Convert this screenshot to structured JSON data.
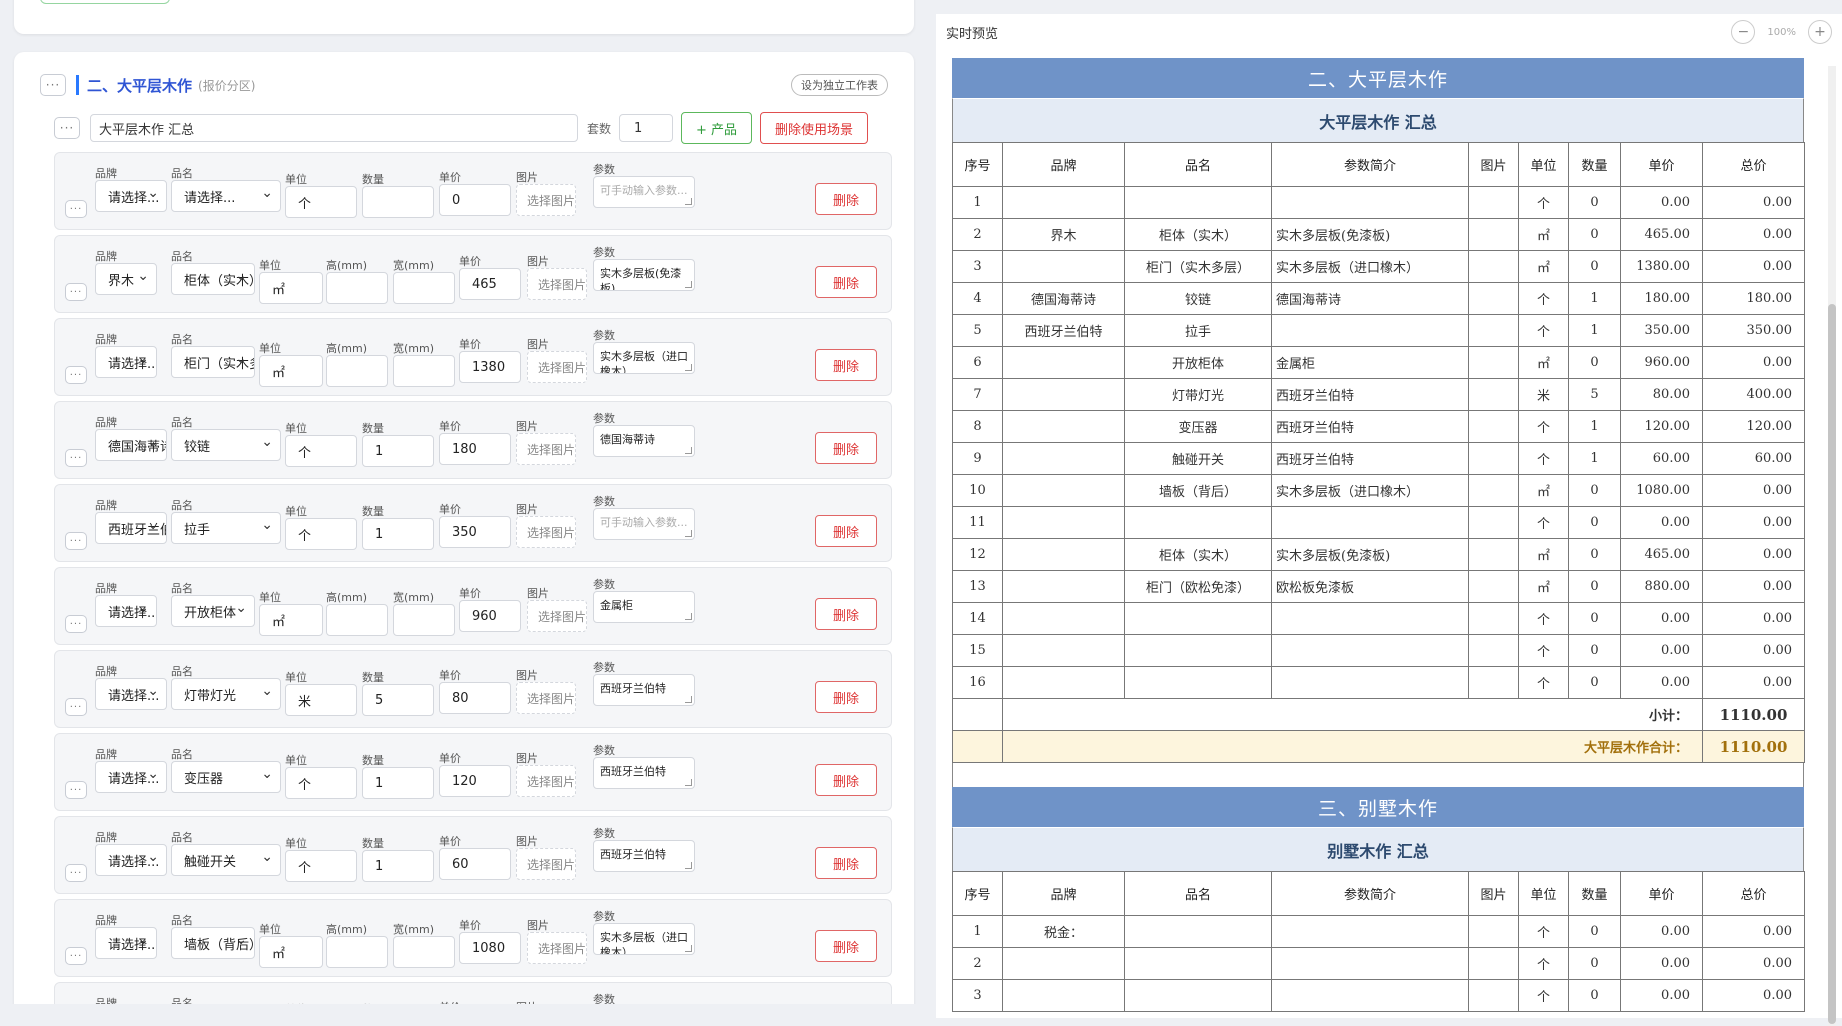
{
  "section": {
    "title": "二、大平层木作",
    "subtitle": "(报价分区)",
    "independent_button": "设为独立工作表",
    "more_label": "···",
    "scene_name": "大平层木作 汇总",
    "qty_label": "套数",
    "qty_value": "1",
    "add_product_button": "+ 产品",
    "delete_scene_button": "删除使用场景"
  },
  "labels": {
    "brand": "品牌",
    "name": "品名",
    "unit": "单位",
    "qty": "数量",
    "height": "高(mm)",
    "width": "宽(mm)",
    "price": "单价",
    "image": "图片",
    "params": "参数",
    "select_image": "选择图片",
    "delete": "删除"
  },
  "items": [
    {
      "brand": "请选择...",
      "name": "请选择...",
      "unit": "个",
      "mode": "qty",
      "qty": "",
      "price": "0",
      "params": "可手动输入参数...",
      "params_placeholder": true
    },
    {
      "brand": "界木",
      "name": "柜体（实木）",
      "unit": "㎡",
      "mode": "hw",
      "h": "",
      "w": "",
      "price": "465",
      "params": "实木多层板(免漆板)"
    },
    {
      "brand": "请选择...",
      "name": "柜门（实木多层）",
      "unit": "㎡",
      "mode": "hw",
      "h": "",
      "w": "",
      "price": "1380",
      "params": "实木多层板（进口橡木）"
    },
    {
      "brand": "德国海蒂诗",
      "name": "铰链",
      "unit": "个",
      "mode": "qty",
      "qty": "1",
      "price": "180",
      "params": "德国海蒂诗"
    },
    {
      "brand": "西班牙兰伯特",
      "name": "拉手",
      "unit": "个",
      "mode": "qty",
      "qty": "1",
      "price": "350",
      "params": "可手动输入参数...",
      "params_placeholder": true
    },
    {
      "brand": "请选择...",
      "name": "开放柜体",
      "unit": "㎡",
      "mode": "hw",
      "h": "",
      "w": "",
      "price": "960",
      "params": "金属柜"
    },
    {
      "brand": "请选择...",
      "name": "灯带灯光",
      "unit": "米",
      "mode": "qty",
      "qty": "5",
      "price": "80",
      "params": "西班牙兰伯特"
    },
    {
      "brand": "请选择...",
      "name": "变压器",
      "unit": "个",
      "mode": "qty",
      "qty": "1",
      "price": "120",
      "params": "西班牙兰伯特"
    },
    {
      "brand": "请选择...",
      "name": "触碰开关",
      "unit": "个",
      "mode": "qty",
      "qty": "1",
      "price": "60",
      "params": "西班牙兰伯特"
    },
    {
      "brand": "请选择...",
      "name": "墙板（背后）",
      "unit": "㎡",
      "mode": "hw",
      "h": "",
      "w": "",
      "price": "1080",
      "params": "实木多层板（进口橡木）"
    },
    {
      "brand": "",
      "name": "",
      "unit": "",
      "mode": "qty",
      "qty": "",
      "price": "",
      "params": ""
    }
  ],
  "preview": {
    "label": "实时预览",
    "zoom": "100%",
    "zoom_out": "−",
    "zoom_in": "+",
    "section2_title": "二、大平层木作",
    "section2_summary": "大平层木作  汇总",
    "columns": [
      "序号",
      "品牌",
      "品名",
      "参数简介",
      "图片",
      "单位",
      "数量",
      "单价",
      "总价"
    ],
    "rows": [
      [
        "1",
        "",
        "",
        "",
        "",
        "个",
        "0",
        "0.00",
        "0.00"
      ],
      [
        "2",
        "界木",
        "柜体（实木）",
        "实木多层板(免漆板)",
        "",
        "㎡",
        "0",
        "465.00",
        "0.00"
      ],
      [
        "3",
        "",
        "柜门（实木多层）",
        "实木多层板（进口橡木）",
        "",
        "㎡",
        "0",
        "1380.00",
        "0.00"
      ],
      [
        "4",
        "德国海蒂诗",
        "铰链",
        "德国海蒂诗",
        "",
        "个",
        "1",
        "180.00",
        "180.00"
      ],
      [
        "5",
        "西班牙兰伯特",
        "拉手",
        "",
        "",
        "个",
        "1",
        "350.00",
        "350.00"
      ],
      [
        "6",
        "",
        "开放柜体",
        "金属柜",
        "",
        "㎡",
        "0",
        "960.00",
        "0.00"
      ],
      [
        "7",
        "",
        "灯带灯光",
        "西班牙兰伯特",
        "",
        "米",
        "5",
        "80.00",
        "400.00"
      ],
      [
        "8",
        "",
        "变压器",
        "西班牙兰伯特",
        "",
        "个",
        "1",
        "120.00",
        "120.00"
      ],
      [
        "9",
        "",
        "触碰开关",
        "西班牙兰伯特",
        "",
        "个",
        "1",
        "60.00",
        "60.00"
      ],
      [
        "10",
        "",
        "墙板（背后）",
        "实木多层板（进口橡木）",
        "",
        "㎡",
        "0",
        "1080.00",
        "0.00"
      ],
      [
        "11",
        "",
        "",
        "",
        "",
        "个",
        "0",
        "0.00",
        "0.00"
      ],
      [
        "12",
        "",
        "柜体（实木）",
        "实木多层板(免漆板)",
        "",
        "㎡",
        "0",
        "465.00",
        "0.00"
      ],
      [
        "13",
        "",
        "柜门（欧松免漆）",
        "欧松板免漆板",
        "",
        "㎡",
        "0",
        "880.00",
        "0.00"
      ],
      [
        "14",
        "",
        "",
        "",
        "",
        "个",
        "0",
        "0.00",
        "0.00"
      ],
      [
        "15",
        "",
        "",
        "",
        "",
        "个",
        "0",
        "0.00",
        "0.00"
      ],
      [
        "16",
        "",
        "",
        "",
        "",
        "个",
        "0",
        "0.00",
        "0.00"
      ]
    ],
    "subtotal_label": "小计：",
    "subtotal_value": "1110.00",
    "grand_label": "大平层木作合计：",
    "grand_value": "1110.00",
    "section3_title": "三、别墅木作",
    "section3_summary": "别墅木作  汇总",
    "rows3": [
      [
        "1",
        "税金：",
        "",
        "",
        "",
        "个",
        "0",
        "0.00",
        "0.00"
      ],
      [
        "2",
        "",
        "",
        "",
        "",
        "个",
        "0",
        "0.00",
        "0.00"
      ],
      [
        "3",
        "",
        "",
        "",
        "",
        "个",
        "0",
        "0.00",
        "0.00"
      ]
    ]
  }
}
